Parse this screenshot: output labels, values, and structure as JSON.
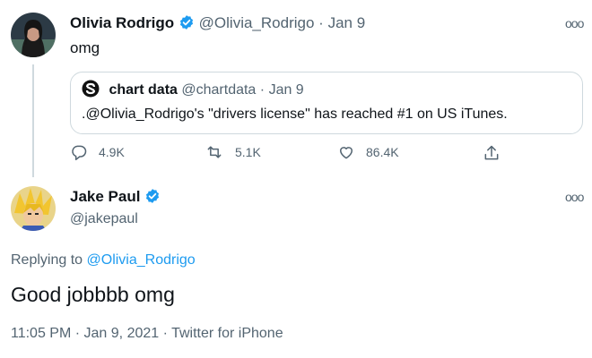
{
  "tweet": {
    "author_name": "Olivia Rodrigo",
    "handle": "@Olivia_Rodrigo",
    "date": "Jan 9",
    "text": "omg",
    "quote": {
      "author_name": "chart data",
      "handle": "@chartdata",
      "date": "Jan 9",
      "text": ".@Olivia_Rodrigo's \"drivers license\" has reached #1 on US iTunes."
    },
    "actions": {
      "replies": "4.9K",
      "retweets": "5.1K",
      "likes": "86.4K"
    }
  },
  "reply": {
    "author_name": "Jake Paul",
    "handle": "@jakepaul",
    "replying_prefix": "Replying to",
    "replying_handle": "@Olivia_Rodrigo",
    "text": "Good jobbbb omg",
    "timestamp": "11:05 PM",
    "date": "Jan 9, 2021",
    "source": "Twitter for iPhone"
  },
  "dot": "·",
  "more_glyph": "ooo",
  "colors": {
    "accent": "#1d9bf0",
    "muted": "#536471",
    "border": "#cfd9de"
  },
  "icons": {
    "verified": "verified-badge-icon",
    "reply": "reply-icon",
    "retweet": "retweet-icon",
    "like": "heart-icon",
    "share": "share-icon",
    "more": "more-icon"
  }
}
